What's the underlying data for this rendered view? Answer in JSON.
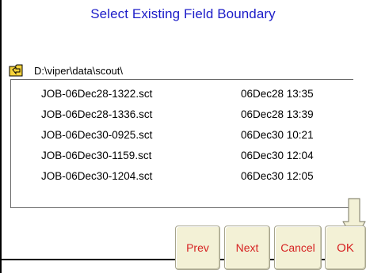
{
  "dialog": {
    "title": "Select Existing Field Boundary"
  },
  "path": {
    "icon": "folder-up-icon",
    "text": "D:\\viper\\data\\scout\\"
  },
  "files": [
    {
      "name": "JOB-06Dec28-1322.sct",
      "date": "06Dec28 13:35"
    },
    {
      "name": "JOB-06Dec28-1336.sct",
      "date": "06Dec28 13:39"
    },
    {
      "name": "JOB-06Dec30-0925.sct",
      "date": "06Dec30 10:21"
    },
    {
      "name": "JOB-06Dec30-1159.sct",
      "date": "06Dec30 12:04"
    },
    {
      "name": "JOB-06Dec30-1204.sct",
      "date": "06Dec30 12:05"
    }
  ],
  "buttons": {
    "prev": "Prev",
    "next": "Next",
    "cancel": "Cancel",
    "ok": "OK"
  },
  "colors": {
    "title": "#1c1cc8",
    "button_text": "#d62222",
    "button_bg": "#f3f1d6"
  }
}
